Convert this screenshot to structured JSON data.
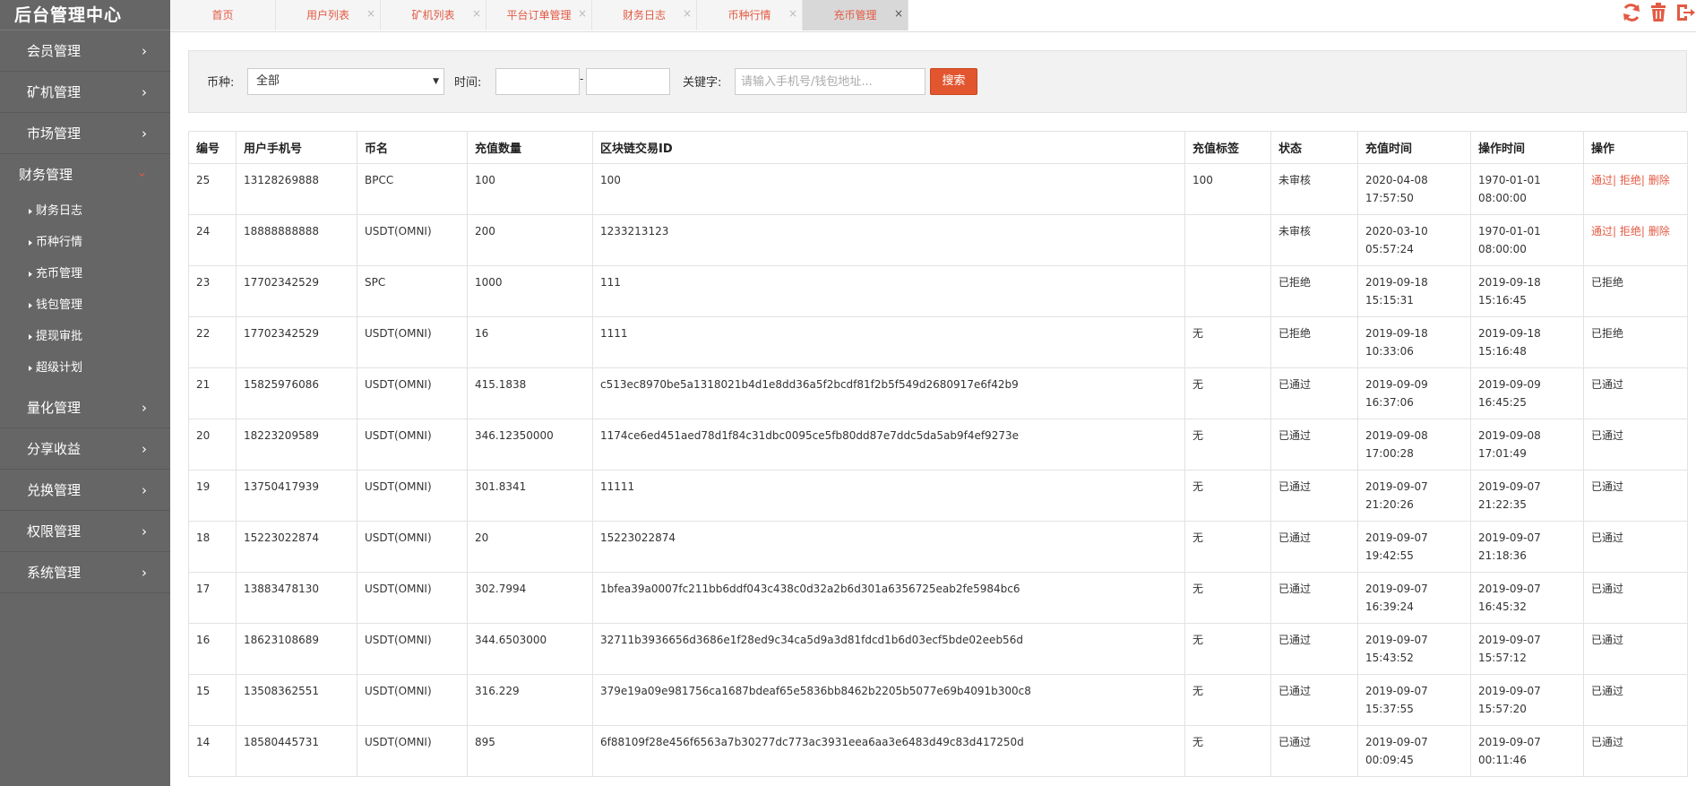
{
  "sidebar": {
    "title": "后台管理中心",
    "items": [
      {
        "label": "会员管理"
      },
      {
        "label": "矿机管理"
      },
      {
        "label": "市场管理"
      },
      {
        "label": "财务管理"
      },
      {
        "label": "量化管理"
      },
      {
        "label": "分享收益"
      },
      {
        "label": "兑换管理"
      },
      {
        "label": "权限管理"
      },
      {
        "label": "系统管理"
      }
    ],
    "sub_items": [
      "财务日志",
      "币种行情",
      "充币管理",
      "钱包管理",
      "提现审批",
      "超级计划"
    ]
  },
  "tabs": [
    {
      "label": "首页"
    },
    {
      "label": "用户列表"
    },
    {
      "label": "矿机列表"
    },
    {
      "label": "平台订单管理"
    },
    {
      "label": "财务日志"
    },
    {
      "label": "币种行情"
    },
    {
      "label": "充币管理"
    }
  ],
  "search": {
    "coin_label": "币种:",
    "coin_value": "全部",
    "time_label": "时间:",
    "dash": "-",
    "keyword_label": "关键字:",
    "keyword_placeholder": "请输入手机号/钱包地址...",
    "button": "搜索"
  },
  "table": {
    "headers": [
      "编号",
      "用户手机号",
      "币名",
      "充值数量",
      "区块链交易ID",
      "充值标签",
      "状态",
      "充值时间",
      "操作时间",
      "操作"
    ],
    "action_links": [
      "通过",
      "拒绝",
      "删除"
    ],
    "rows": [
      {
        "id": "25",
        "phone": "13128269888",
        "coin": "BPCC",
        "amount": "100",
        "txid": "100",
        "tag": "100",
        "status": "未审核",
        "charge_date": "2020-04-08",
        "charge_time": "17:57:50",
        "op_date": "1970-01-01",
        "op_time": "08:00:00",
        "op": ""
      },
      {
        "id": "24",
        "phone": "18888888888",
        "coin": "USDT(OMNI)",
        "amount": "200",
        "txid": "1233213123",
        "tag": "",
        "status": "未审核",
        "charge_date": "2020-03-10",
        "charge_time": "05:57:24",
        "op_date": "1970-01-01",
        "op_time": "08:00:00",
        "op": ""
      },
      {
        "id": "23",
        "phone": "17702342529",
        "coin": "SPC",
        "amount": "1000",
        "txid": "111",
        "tag": "",
        "status": "已拒绝",
        "charge_date": "2019-09-18",
        "charge_time": "15:15:31",
        "op_date": "2019-09-18",
        "op_time": "15:16:45",
        "op": "已拒绝"
      },
      {
        "id": "22",
        "phone": "17702342529",
        "coin": "USDT(OMNI)",
        "amount": "16",
        "txid": "1111",
        "tag": "无",
        "status": "已拒绝",
        "charge_date": "2019-09-18",
        "charge_time": "10:33:06",
        "op_date": "2019-09-18",
        "op_time": "15:16:48",
        "op": "已拒绝"
      },
      {
        "id": "21",
        "phone": "15825976086",
        "coin": "USDT(OMNI)",
        "amount": "415.1838",
        "txid": "c513ec8970be5a1318021b4d1e8dd36a5f2bcdf81f2b5f549d2680917e6f42b9",
        "tag": "无",
        "status": "已通过",
        "charge_date": "2019-09-09",
        "charge_time": "16:37:06",
        "op_date": "2019-09-09",
        "op_time": "16:45:25",
        "op": "已通过"
      },
      {
        "id": "20",
        "phone": "18223209589",
        "coin": "USDT(OMNI)",
        "amount": "346.12350000",
        "txid": "1174ce6ed451aed78d1f84c31dbc0095ce5fb80dd87e7ddc5da5ab9f4ef9273e",
        "tag": "无",
        "status": "已通过",
        "charge_date": "2019-09-08",
        "charge_time": "17:00:28",
        "op_date": "2019-09-08",
        "op_time": "17:01:49",
        "op": "已通过"
      },
      {
        "id": "19",
        "phone": "13750417939",
        "coin": "USDT(OMNI)",
        "amount": "301.8341",
        "txid": "11111",
        "tag": "无",
        "status": "已通过",
        "charge_date": "2019-09-07",
        "charge_time": "21:20:26",
        "op_date": "2019-09-07",
        "op_time": "21:22:35",
        "op": "已通过"
      },
      {
        "id": "18",
        "phone": "15223022874",
        "coin": "USDT(OMNI)",
        "amount": "20",
        "txid": "15223022874",
        "tag": "无",
        "status": "已通过",
        "charge_date": "2019-09-07",
        "charge_time": "19:42:55",
        "op_date": "2019-09-07",
        "op_time": "21:18:36",
        "op": "已通过"
      },
      {
        "id": "17",
        "phone": "13883478130",
        "coin": "USDT(OMNI)",
        "amount": "302.7994",
        "txid": "1bfea39a0007fc211bb6ddf043c438c0d32a2b6d301a6356725eab2fe5984bc6",
        "tag": "无",
        "status": "已通过",
        "charge_date": "2019-09-07",
        "charge_time": "16:39:24",
        "op_date": "2019-09-07",
        "op_time": "16:45:32",
        "op": "已通过"
      },
      {
        "id": "16",
        "phone": "18623108689",
        "coin": "USDT(OMNI)",
        "amount": "344.6503000",
        "txid": "32711b3936656d3686e1f28ed9c34ca5d9a3d81fdcd1b6d03ecf5bde02eeb56d",
        "tag": "无",
        "status": "已通过",
        "charge_date": "2019-09-07",
        "charge_time": "15:43:52",
        "op_date": "2019-09-07",
        "op_time": "15:57:12",
        "op": "已通过"
      },
      {
        "id": "15",
        "phone": "13508362551",
        "coin": "USDT(OMNI)",
        "amount": "316.229",
        "txid": "379e19a09e981756ca1687bdeaf65e5836bb8462b2205b5077e69b4091b300c8",
        "tag": "无",
        "status": "已通过",
        "charge_date": "2019-09-07",
        "charge_time": "15:37:55",
        "op_date": "2019-09-07",
        "op_time": "15:57:20",
        "op": "已通过"
      },
      {
        "id": "14",
        "phone": "18580445731",
        "coin": "USDT(OMNI)",
        "amount": "895",
        "txid": "6f88109f28e456f6563a7b30277dc773ac3931eea6aa3e6483d49c83d417250d",
        "tag": "无",
        "status": "已通过",
        "charge_date": "2019-09-07",
        "charge_time": "00:09:45",
        "op_date": "2019-09-07",
        "op_time": "00:11:46",
        "op": "已通过"
      }
    ]
  },
  "colors": {
    "sidebar_bg": "#666666",
    "accent": "#e35a43",
    "search_button": "#e2562f"
  },
  "icons": [
    "refresh-icon",
    "trash-icon",
    "exit-icon",
    "chevron-right-icon",
    "submenu-triangle-icon",
    "close-icon",
    "select-arrow-icon"
  ]
}
